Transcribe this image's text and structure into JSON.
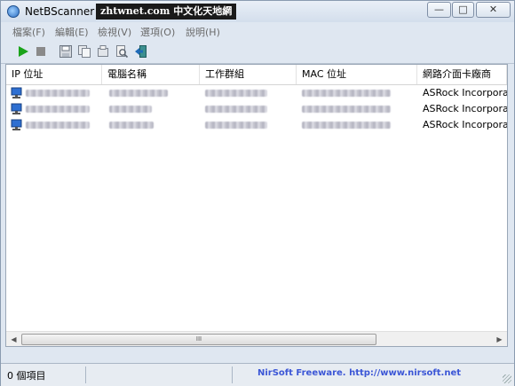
{
  "window": {
    "title": "NetBScanner",
    "watermark": "zhtwnet.com 中文化天地網",
    "controls": {
      "minimize": "—",
      "maximize": "□",
      "close": "✕"
    }
  },
  "menu": {
    "items": [
      {
        "label": "檔案(F)"
      },
      {
        "label": "編輯(E)"
      },
      {
        "label": "檢視(V)"
      },
      {
        "label": "選項(O)"
      },
      {
        "label": "說明(H)"
      }
    ]
  },
  "toolbar": {
    "buttons": [
      {
        "icon": "play-icon",
        "color": "#1aa31a"
      },
      {
        "icon": "stop-icon",
        "color": "#8a8a8a"
      },
      {
        "icon": "save-icon"
      },
      {
        "icon": "copy-icon"
      },
      {
        "icon": "properties-icon"
      },
      {
        "icon": "find-icon"
      },
      {
        "icon": "exit-icon"
      }
    ]
  },
  "table": {
    "columns": [
      "IP 位址",
      "電腦名稱",
      "工作群組",
      "MAC 位址",
      "網路介面卡廠商"
    ],
    "rows": [
      {
        "vendor": "ASRock Incorporat"
      },
      {
        "vendor": "ASRock Incorporat"
      },
      {
        "vendor": "ASRock Incorporat"
      }
    ]
  },
  "scrollbar": {
    "left_arrow": "◀",
    "right_arrow": "▶",
    "grip": "III"
  },
  "status": {
    "count": "0 個項目",
    "link": "NirSoft Freeware.  http://www.nirsoft.net"
  },
  "colors": {
    "accent_link": "#3b56d6",
    "chrome": "#dfe7f1"
  }
}
